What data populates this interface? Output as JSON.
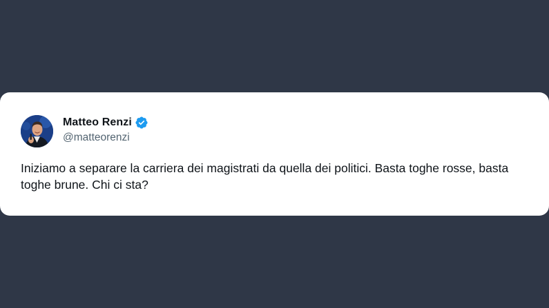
{
  "tweet": {
    "author": {
      "name": "Matteo Renzi",
      "handle": "@matteorenzi",
      "verified": true,
      "avatar_icon": "profile-photo"
    },
    "text": "Iniziamo a separare la carriera dei magistrati da quella dei politici. Basta toghe rosse, basta toghe brune. Chi ci sta?"
  },
  "colors": {
    "background": "#2f3747",
    "card": "#ffffff",
    "name_text": "#0f1419",
    "handle_text": "#536471",
    "verified_blue": "#1d9bf0"
  }
}
